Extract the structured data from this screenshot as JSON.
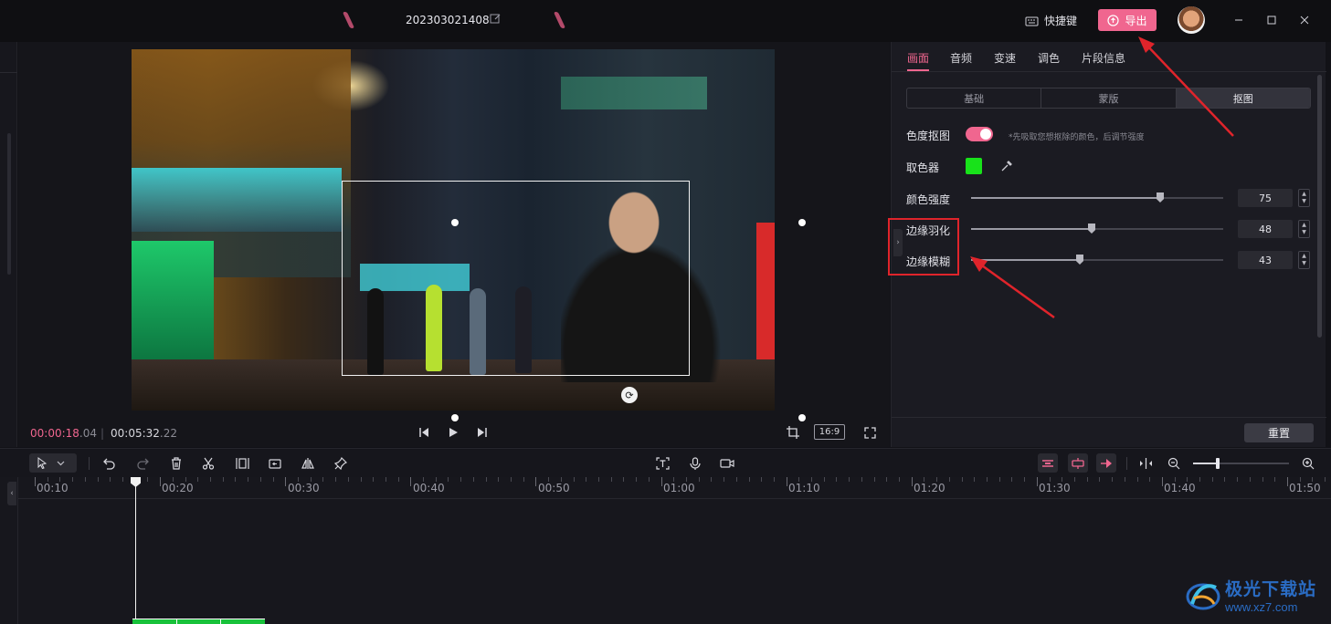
{
  "titlebar": {
    "project_name": "202303021408",
    "shortcut_label": "快捷键",
    "export_label": "导出",
    "icons": [
      "edit-icon",
      "keyboard-icon",
      "export-upload-icon",
      "minimize-icon",
      "maximize-icon",
      "close-icon"
    ]
  },
  "player": {
    "current_time": "00:00:18",
    "current_frames": ".04",
    "separator": "|",
    "total_time": "00:05:32",
    "total_frames": ".22",
    "aspect_ratio": "16:9",
    "icons": [
      "skip-start-icon",
      "play-icon",
      "skip-end-icon",
      "crop-icon",
      "fullscreen-icon",
      "rotate-icon"
    ]
  },
  "panel": {
    "tabs": [
      {
        "label": "画面",
        "active": true
      },
      {
        "label": "音频",
        "active": false
      },
      {
        "label": "变速",
        "active": false
      },
      {
        "label": "调色",
        "active": false
      },
      {
        "label": "片段信息",
        "active": false
      }
    ],
    "segments": [
      "基础",
      "蒙版",
      "抠图"
    ],
    "active_segment": "抠图",
    "chroma_key": {
      "label": "色度抠图",
      "enabled": true,
      "hint": "*先吸取您想抠除的颜色，后调节强度"
    },
    "color_picker": {
      "label": "取色器",
      "color": "#18e21a"
    },
    "sliders": [
      {
        "label": "颜色强度",
        "value": "75",
        "fraction": 0.75
      },
      {
        "label": "边缘羽化",
        "value": "48",
        "fraction": 0.48
      },
      {
        "label": "边缘模糊",
        "value": "43",
        "fraction": 0.43
      }
    ],
    "reset_label": "重置",
    "accent_color": "#f0668f"
  },
  "timeline": {
    "ruler_labels": [
      "00:10",
      "00:20",
      "00:30",
      "00:40",
      "00:50",
      "01:00",
      "01:10",
      "01:20",
      "01:30",
      "01:40",
      "01:50"
    ],
    "zoom_fraction": 0.26,
    "toolbar_icons": [
      "select-arrow-icon",
      "chevron-down-icon",
      "undo-icon",
      "redo-icon",
      "delete-icon",
      "split-icon",
      "freeze-icon",
      "reverse-icon",
      "mirror-icon",
      "pin-icon",
      "text-recognition-icon",
      "microphone-icon",
      "camera-record-icon",
      "snap-icon",
      "link-icon",
      "preview-axis-icon",
      "split-axis-icon",
      "zoom-out-icon",
      "zoom-in-icon"
    ]
  },
  "watermark": {
    "name": "极光下载站",
    "url": "www.xz7.com"
  }
}
